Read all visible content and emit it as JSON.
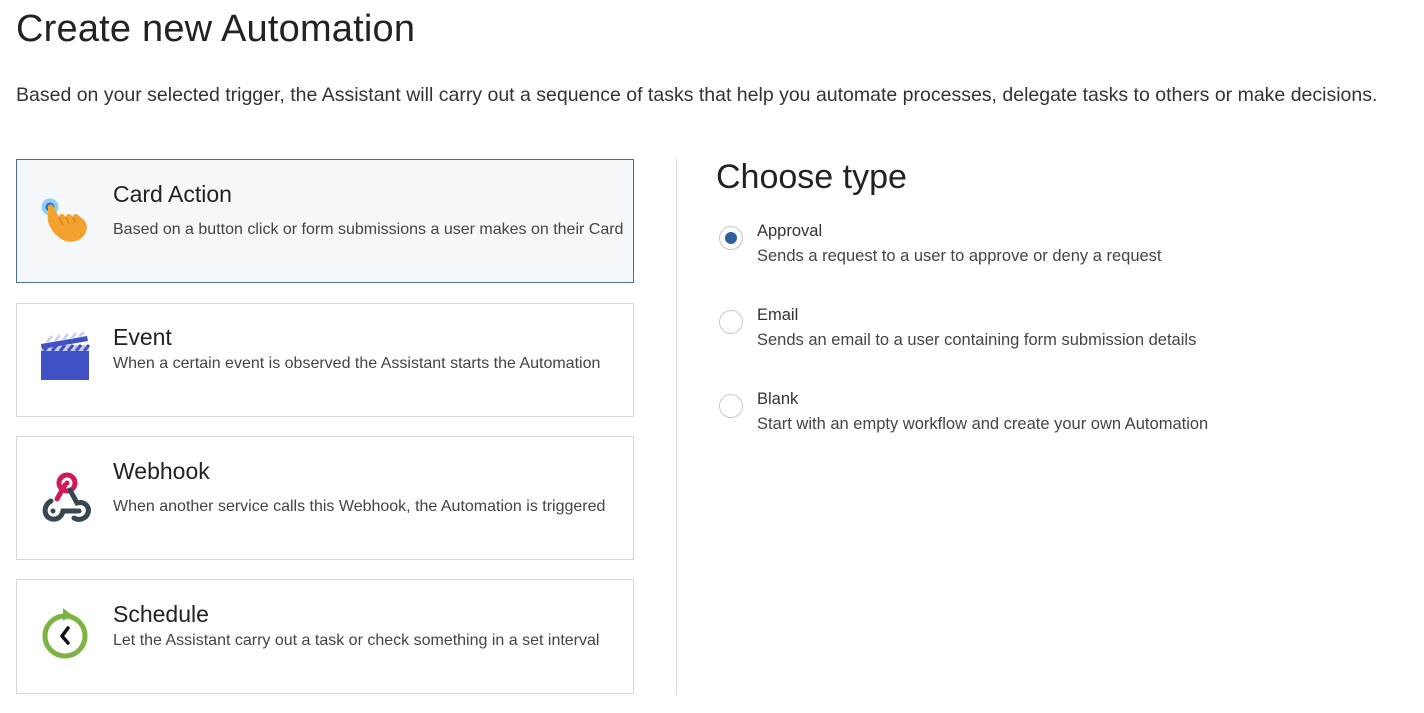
{
  "page": {
    "title": "Create new Automation",
    "description": "Based on your selected trigger, the Assistant will carry out a sequence of tasks that help you automate processes, delegate tasks to others or make decisions."
  },
  "triggers": [
    {
      "title": "Card Action",
      "description": "Based on a button click or form submissions a user makes on their Card",
      "icon": "hand-tap-icon",
      "selected": true
    },
    {
      "title": "Event",
      "description": "When a certain event is observed the Assistant starts the Automation",
      "icon": "clapperboard-icon",
      "selected": false
    },
    {
      "title": "Webhook",
      "description": "When another service calls this Webhook, the Automation is triggered",
      "icon": "webhook-icon",
      "selected": false
    },
    {
      "title": "Schedule",
      "description": "Let the Assistant carry out a task or check something in a set interval",
      "icon": "schedule-clock-icon",
      "selected": false
    }
  ],
  "type_panel": {
    "heading": "Choose type",
    "options": [
      {
        "label": "Approval",
        "description": "Sends a request to a user to approve or deny a request",
        "checked": true
      },
      {
        "label": "Email",
        "description": "Sends an email to a user containing form submission details",
        "checked": false
      },
      {
        "label": "Blank",
        "description": "Start with an empty workflow and create your own Automation",
        "checked": false
      }
    ]
  },
  "colors": {
    "selected_border": "#4e6e96",
    "selected_bg": "#f4f8fb",
    "radio_checked": "#2f5f9c"
  }
}
